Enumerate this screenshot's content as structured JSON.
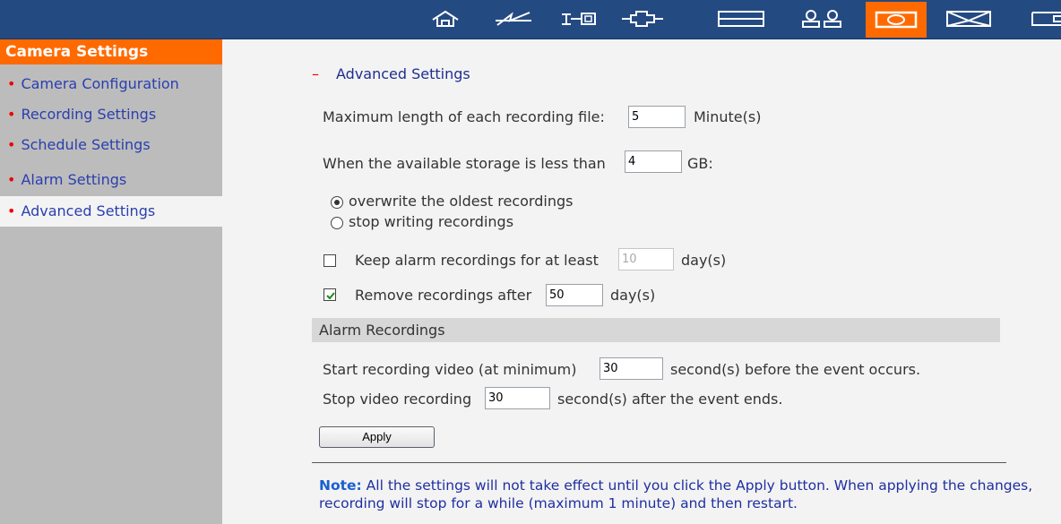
{
  "toolbar": {
    "icons": [
      "home-icon",
      "network-icon",
      "device-icon",
      "connection-icon",
      "panel-icon",
      "users-icon",
      "camera-icon",
      "envelope-icon",
      "partial-icon"
    ],
    "active": "camera-icon",
    "colors": {
      "bar": "#244a82",
      "active": "#ff6a00",
      "icon": "#ffffff"
    }
  },
  "sidebar": {
    "title": "Camera Settings",
    "items": [
      {
        "label": "Camera Configuration",
        "active": false
      },
      {
        "label": "Recording Settings",
        "active": false
      },
      {
        "label": "Schedule Settings",
        "active": false
      },
      {
        "label": "Alarm Settings",
        "active": false
      },
      {
        "label": "Advanced Settings",
        "active": true
      }
    ],
    "bullet": "•"
  },
  "main": {
    "section_dash": "–",
    "section_title": "Advanced Settings",
    "max_length": {
      "label": "Maximum length of each recording file:",
      "value": "5",
      "unit": "Minute(s)"
    },
    "storage": {
      "label": "When the available storage is less than",
      "value": "4",
      "unit": "GB:"
    },
    "overwrite_options": [
      {
        "label": "overwrite the oldest recordings",
        "selected": true
      },
      {
        "label": "stop writing recordings",
        "selected": false
      }
    ],
    "keep_alarm": {
      "label": "Keep alarm recordings for at least",
      "value": "10",
      "unit": "day(s)",
      "checked": false
    },
    "remove_after": {
      "label": "Remove recordings after",
      "value": "50",
      "unit": "day(s)",
      "checked": true
    },
    "alarm_section_title": "Alarm Recordings",
    "pre_record": {
      "label": "Start recording video (at minimum)",
      "value": "30",
      "suffix": "second(s) before the event occurs."
    },
    "post_record": {
      "label": "Stop video recording",
      "value": "30",
      "suffix": "second(s) after the event ends."
    },
    "apply_label": "Apply",
    "note_label": "Note:",
    "note_text": " All the settings will not take effect until you click the Apply button. When applying the changes, recording will stop for a while (maximum 1 minute) and then restart."
  }
}
